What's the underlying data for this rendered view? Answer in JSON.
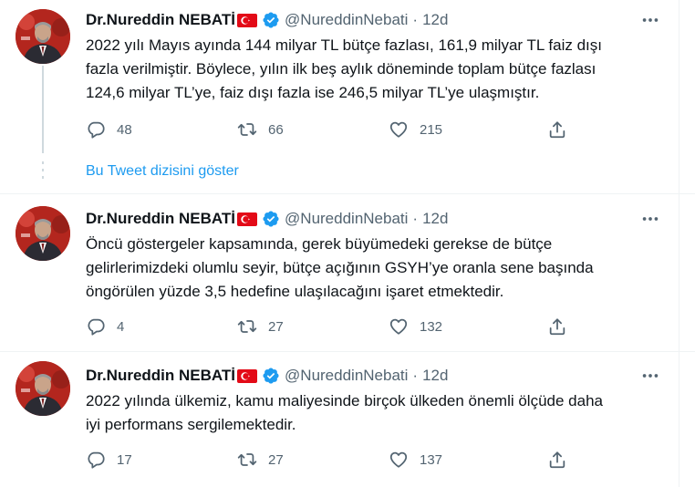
{
  "show_thread_label": "Bu Tweet dizisini göster",
  "colors": {
    "accent": "#1d9bf0",
    "secondary_text": "#536471",
    "flag_red": "#e30a17"
  },
  "icons": [
    "verified-badge-icon",
    "turkish-flag-icon",
    "more-icon",
    "reply-icon",
    "retweet-icon",
    "like-icon",
    "share-icon"
  ],
  "tweets": [
    {
      "author": {
        "name": "Dr.Nureddin NEBATİ",
        "handle": "@NureddinNebati"
      },
      "dot": "·",
      "time": "12d",
      "lines": [
        "2022 yılı Mayıs ayında 144 milyar TL bütçe fazlası, 161,9 milyar TL faiz dışı",
        "fazla verilmiştir. Böylece, yılın ilk beş aylık döneminde toplam bütçe fazlası",
        "124,6 milyar TL’ye, faiz dışı fazla ise 246,5 milyar TL’ye ulaşmıştır."
      ],
      "replies": "48",
      "retweets": "66",
      "likes": "215"
    },
    {
      "author": {
        "name": "Dr.Nureddin NEBATİ",
        "handle": "@NureddinNebati"
      },
      "dot": "·",
      "time": "12d",
      "lines": [
        "Öncü göstergeler kapsamında, gerek büyümedeki gerekse de bütçe",
        "gelirlerimizdeki olumlu seyir, bütçe açığının GSYH’ye oranla sene başında",
        "öngörülen yüzde 3,5 hedefine ulaşılacağını işaret etmektedir."
      ],
      "replies": "4",
      "retweets": "27",
      "likes": "132"
    },
    {
      "author": {
        "name": "Dr.Nureddin NEBATİ",
        "handle": "@NureddinNebati"
      },
      "dot": "·",
      "time": "12d",
      "lines": [
        "2022 yılında ülkemiz, kamu maliyesinde birçok ülkeden önemli ölçüde daha",
        "iyi performans sergilemektedir."
      ],
      "replies": "17",
      "retweets": "27",
      "likes": "137"
    }
  ]
}
